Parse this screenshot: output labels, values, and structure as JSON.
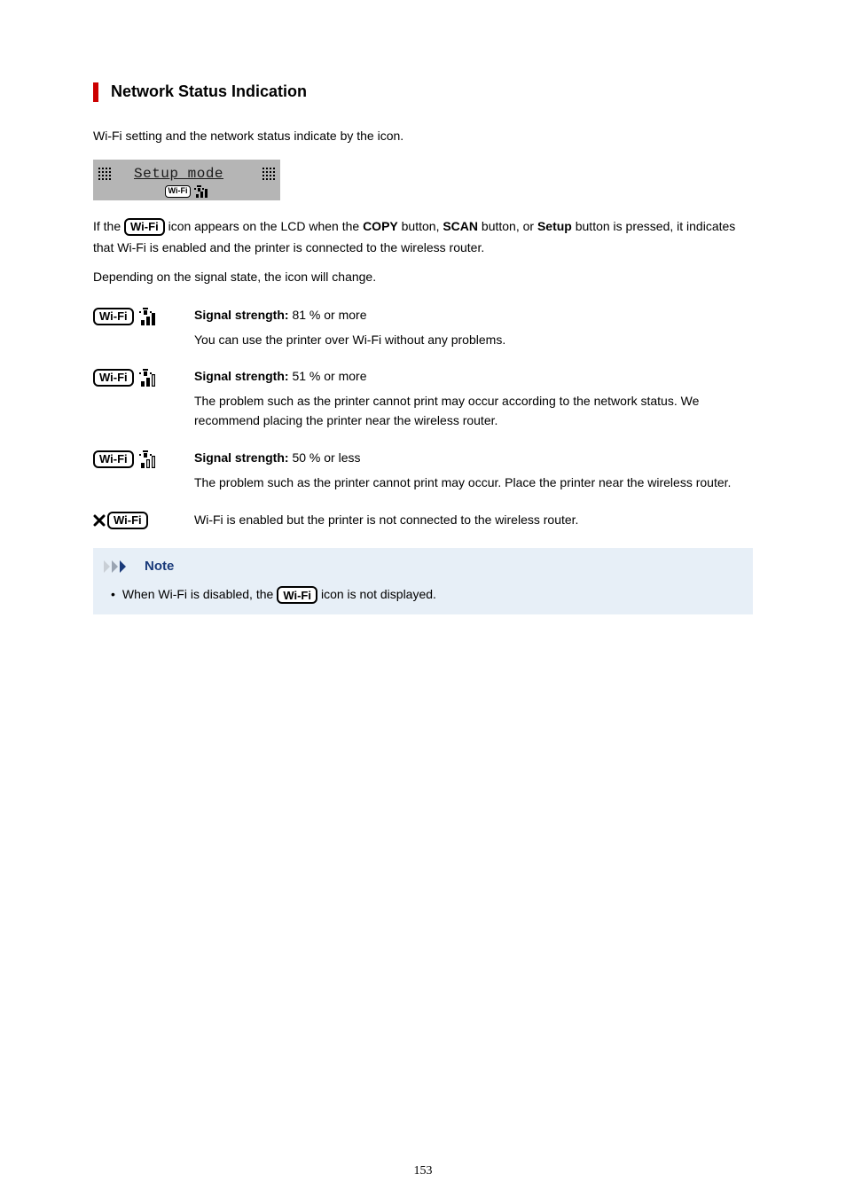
{
  "section_title": "Network Status Indication",
  "intro": "Wi-Fi setting and the network status indicate by the icon.",
  "lcd": {
    "line1": "Setup mode",
    "wifi_label": "Wi-Fi"
  },
  "if_para": {
    "prefix": "If the ",
    "mid": " icon appears on the LCD when the ",
    "copy": "COPY",
    "b1": " button, ",
    "scan": "SCAN",
    "b2": " button, or ",
    "setup": "Setup",
    "suffix": " button is pressed, it indicates that Wi-Fi is enabled and the printer is connected to the wireless router."
  },
  "depending": "Depending on the signal state, the icon will change.",
  "signals": [
    {
      "title_bold": "Signal strength:",
      "title_rest": " 81 % or more",
      "desc": "You can use the printer over Wi-Fi without any problems."
    },
    {
      "title_bold": "Signal strength:",
      "title_rest": " 51 % or more",
      "desc": "The problem such as the printer cannot print may occur according to the network status. We recommend placing the printer near the wireless router."
    },
    {
      "title_bold": "Signal strength:",
      "title_rest": " 50 % or less",
      "desc": "The problem such as the printer cannot print may occur. Place the printer near the wireless router."
    },
    {
      "title_bold": "",
      "title_rest": "",
      "desc": "Wi-Fi is enabled but the printer is not connected to the wireless router."
    }
  ],
  "note": {
    "header": "Note",
    "prefix": "When Wi-Fi is disabled, the ",
    "suffix": " icon is not displayed."
  },
  "wifi_label": "Wi-Fi",
  "page_number": "153"
}
